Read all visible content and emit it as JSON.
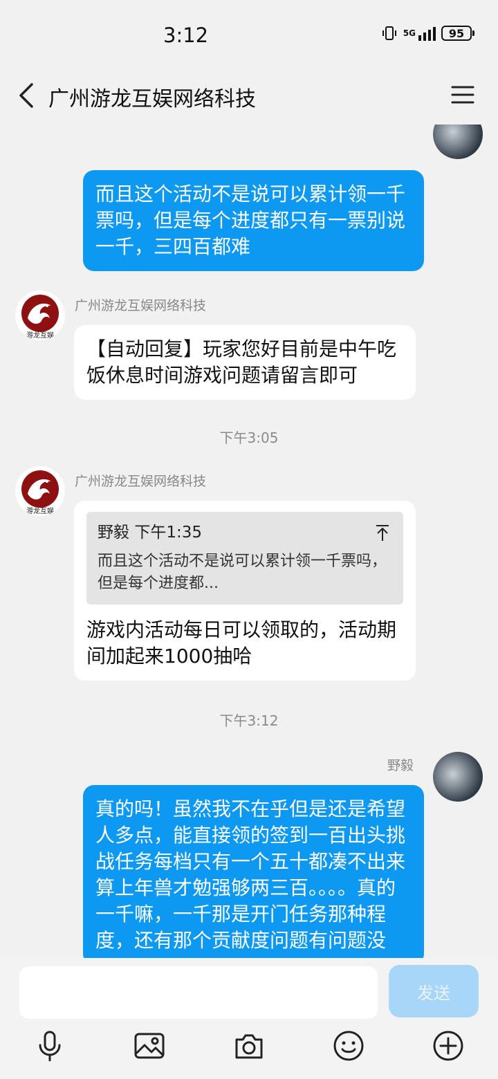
{
  "status_bar": {
    "time": "3:12",
    "network": "5G",
    "network_sub": "1l",
    "battery": "95"
  },
  "header": {
    "title": "广州游龙互娱网络科技"
  },
  "messages": {
    "m1": {
      "text": "而且这个活动不是说可以累计领一千票吗，但是每个进度都只有一票别说一千，三四百都难"
    },
    "m2": {
      "sender": "广州游龙互娱网络科技",
      "text": "【自动回复】玩家您好目前是中午吃饭休息时间游戏问题请留言即可"
    },
    "ts1": "下午3:05",
    "m3": {
      "sender": "广州游龙互娱网络科技",
      "quote_author": "野毅",
      "quote_time": "下午1:35",
      "quote_text": "而且这个活动不是说可以累计领一千票吗，但是每个进度都...",
      "text": "游戏内活动每日可以领取的，活动期间加起来1000抽哈"
    },
    "ts2": "下午3:12",
    "m4": {
      "sender": "野毅",
      "text": "真的吗！虽然我不在乎但是还是希望人多点，能直接领的签到一百出头挑战任务每档只有一个五十都凑不出来算上年兽才勉强够两三百。。。。真的一千嘛，一千那是开门任务那种程度，还有那个贡献度问题有问题没"
    }
  },
  "company_logo_text": "游龙互娱",
  "input": {
    "send_label": "发送"
  },
  "toolbar_icons": [
    "microphone-icon",
    "image-icon",
    "camera-icon",
    "emoji-icon",
    "plus-icon"
  ],
  "colors": {
    "bubble_self": "#0d98f2",
    "send_button": "#a7d6f8",
    "background": "#f1f1f1"
  }
}
